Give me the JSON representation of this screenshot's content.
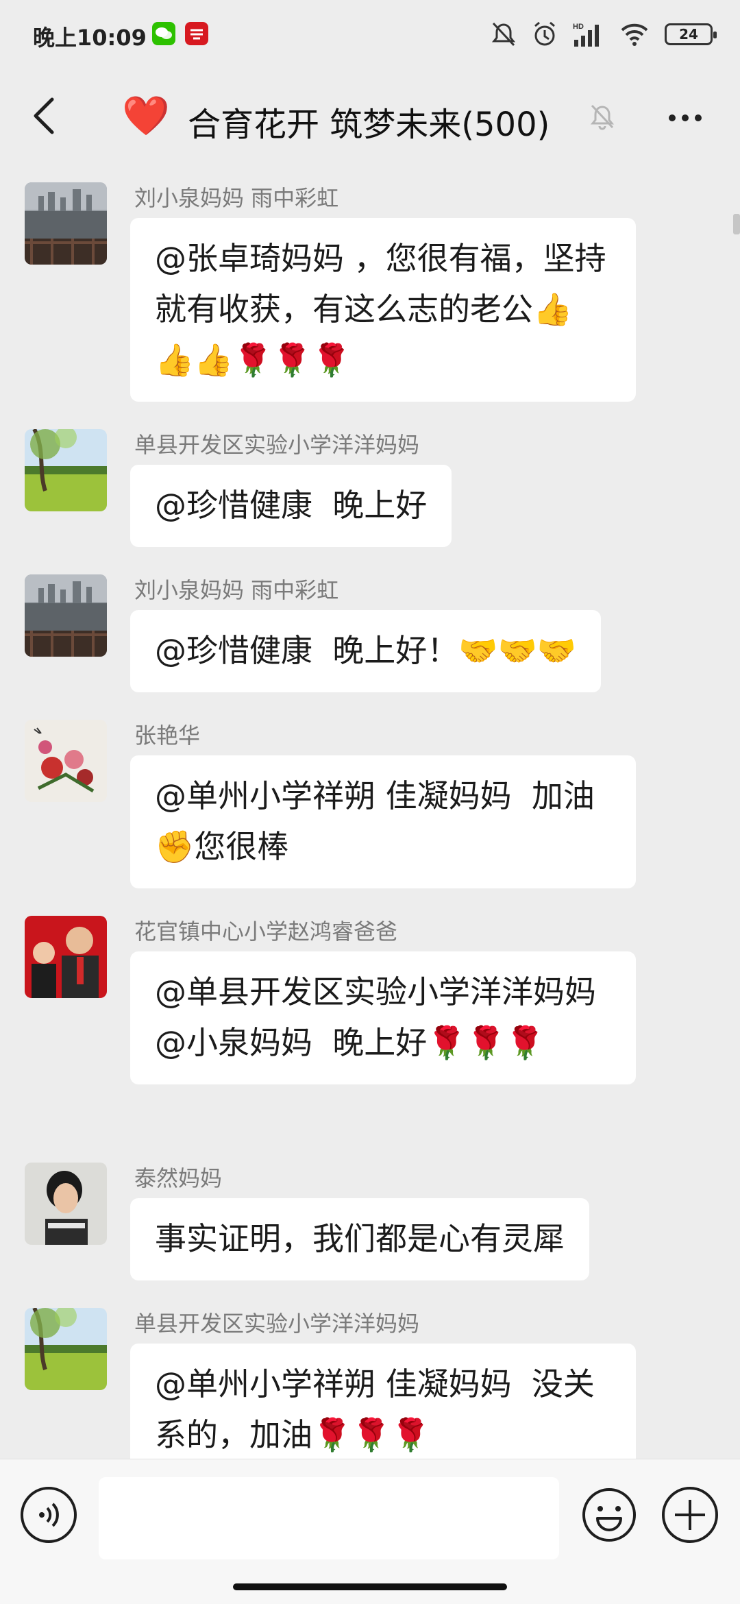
{
  "status_bar": {
    "time": "晚上10:09",
    "battery": "24",
    "app_icons": [
      "wechat-icon",
      "xuexi-icon"
    ],
    "status_icons": [
      "mute-icon",
      "alarm-icon",
      "hd-signal-icon",
      "wifi-icon",
      "battery-icon"
    ]
  },
  "header": {
    "heart": "❤️",
    "title": "合育花开 筑梦未来(500)"
  },
  "messages": [
    {
      "sender": "刘小泉妈妈  雨中彩虹",
      "text": "@张卓琦妈妈 ，您很有福，坚持就有收获，有这么志的老公👍👍👍🌹🌹🌹"
    },
    {
      "sender": "单县开发区实验小学洋洋妈妈",
      "text": "@珍惜健康  晚上好"
    },
    {
      "sender": "刘小泉妈妈  雨中彩虹",
      "text": "@珍惜健康  晚上好！🤝🤝🤝"
    },
    {
      "sender": "张艳华",
      "text": "@单州小学祥朔 佳凝妈妈  加油✊您很棒"
    },
    {
      "sender": "花官镇中心小学赵鸿睿爸爸",
      "text": "@单县开发区实验小学洋洋妈妈 @小泉妈妈  晚上好🌹🌹🌹"
    },
    {
      "sender": "泰然妈妈",
      "text": "事实证明，我们都是心有灵犀"
    },
    {
      "sender": "单县开发区实验小学洋洋妈妈",
      "text": "@单州小学祥朔 佳凝妈妈  没关系的，加油🌹🌹🌹"
    }
  ],
  "input": {
    "value": ""
  },
  "colors": {
    "background": "#ededed",
    "bubble": "#ffffff",
    "sender_text": "#7a7a7a",
    "heart": "#e21b2b"
  }
}
